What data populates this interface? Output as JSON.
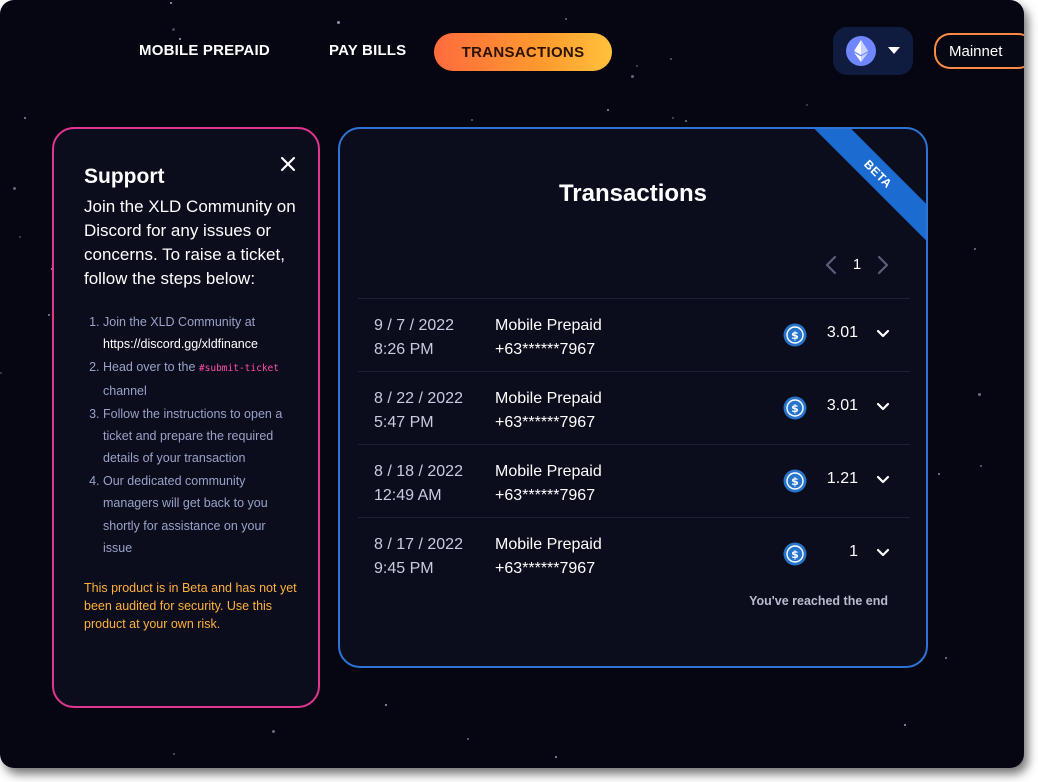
{
  "nav": {
    "items": [
      {
        "label": "MOBILE PREPAID"
      },
      {
        "label": "PAY BILLS"
      },
      {
        "label": "TRANSACTIONS"
      }
    ],
    "chain_icon": "ethereum-icon",
    "network_label": "Mainnet"
  },
  "support": {
    "title": "Support",
    "intro": "Join the XLD Community on Discord for any issues or concerns. To raise a ticket, follow the steps below:",
    "steps": {
      "s1_text": "Join the XLD Community at",
      "s1_link": "https://discord.gg/xldfinance",
      "s2_before": "Head over to the",
      "s2_code": "#submit-ticket",
      "s2_after": "channel",
      "s3_text": "Follow the instructions to open a ticket and prepare the required details of your transaction",
      "s4_text": "Our dedicated community managers will get back to you shortly for assistance on your issue"
    },
    "warning": "This product is in Beta and has not yet been audited for security. Use this product at your own risk.",
    "close_icon": "close-icon"
  },
  "transactions": {
    "title": "Transactions",
    "ribbon": "BETA",
    "page": "1",
    "rows": [
      {
        "date": "9 / 7 / 2022",
        "time": "8:26 PM",
        "type": "Mobile Prepaid",
        "number": "+63******7967",
        "amount": "3.01"
      },
      {
        "date": "8 / 22 / 2022",
        "time": "5:47 PM",
        "type": "Mobile Prepaid",
        "number": "+63******7967",
        "amount": "3.01"
      },
      {
        "date": "8 / 18 / 2022",
        "time": "12:49 AM",
        "type": "Mobile Prepaid",
        "number": "+63******7967",
        "amount": "1.21"
      },
      {
        "date": "8 / 17 / 2022",
        "time": "9:45 PM",
        "type": "Mobile Prepaid",
        "number": "+63******7967",
        "amount": "1"
      }
    ],
    "end_message": "You've reached the end",
    "coin_icon": "usdc-coin-icon"
  },
  "colors": {
    "background": "#050612",
    "support_border": "#e2358f",
    "panel_border": "#2e74d4",
    "accent_orange": "#ff8a45",
    "warning_text": "#ffb13b"
  }
}
